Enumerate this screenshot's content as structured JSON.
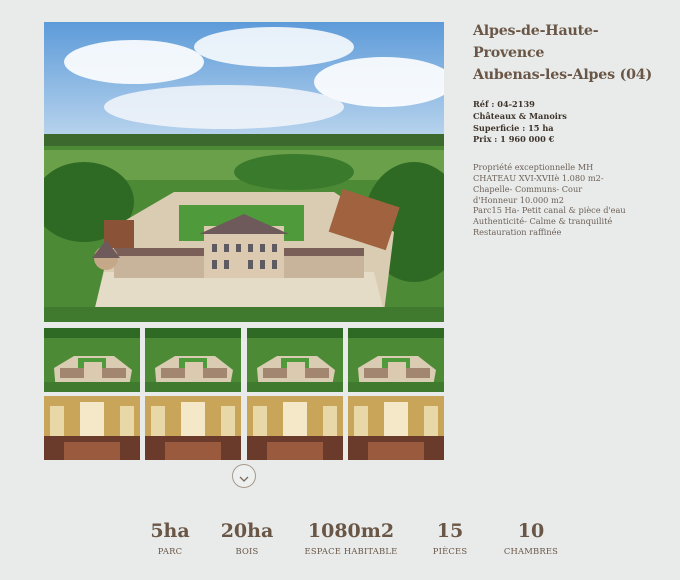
{
  "listing": {
    "region": "Alpes-de-Haute-Provence",
    "town": "Aubenas-les-Alpes (04)",
    "ref": "Réf : 04-2139",
    "category": "Châteaux & Manoirs",
    "surface": "Superficie : 15 ha",
    "price": "Prix : 1 960 000 €",
    "description": [
      "Propriété exceptionnelle MH",
      "CHATEAU XVI-XVIIè 1.080 m2-",
      "Chapelle- Communs- Cour",
      "d'Honneur 10.000 m2",
      "Parc15 Ha- Petit canal & pièce d'eau",
      "Authenticité- Calme & tranquilité",
      "Restauration raffinée"
    ]
  },
  "gallery": {
    "main_alt": "Aerial view of château",
    "thumbnails": [
      {
        "kind": "aerial"
      },
      {
        "kind": "aerial"
      },
      {
        "kind": "aerial"
      },
      {
        "kind": "aerial"
      },
      {
        "kind": "interior"
      },
      {
        "kind": "interior"
      },
      {
        "kind": "interior"
      },
      {
        "kind": "interior"
      }
    ],
    "more_icon": "chevron-down-icon"
  },
  "stats": [
    {
      "value": "5ha",
      "label": "PARC"
    },
    {
      "value": "20ha",
      "label": "BOIS"
    },
    {
      "value": "1080m2",
      "label": "ESPACE HABITABLE"
    },
    {
      "value": "15",
      "label": "PIÈCES"
    },
    {
      "value": "10",
      "label": "CHAMBRES"
    }
  ],
  "colors": {
    "background": "#e8ebea",
    "title": "#6a5646",
    "text": "#6d6158"
  }
}
